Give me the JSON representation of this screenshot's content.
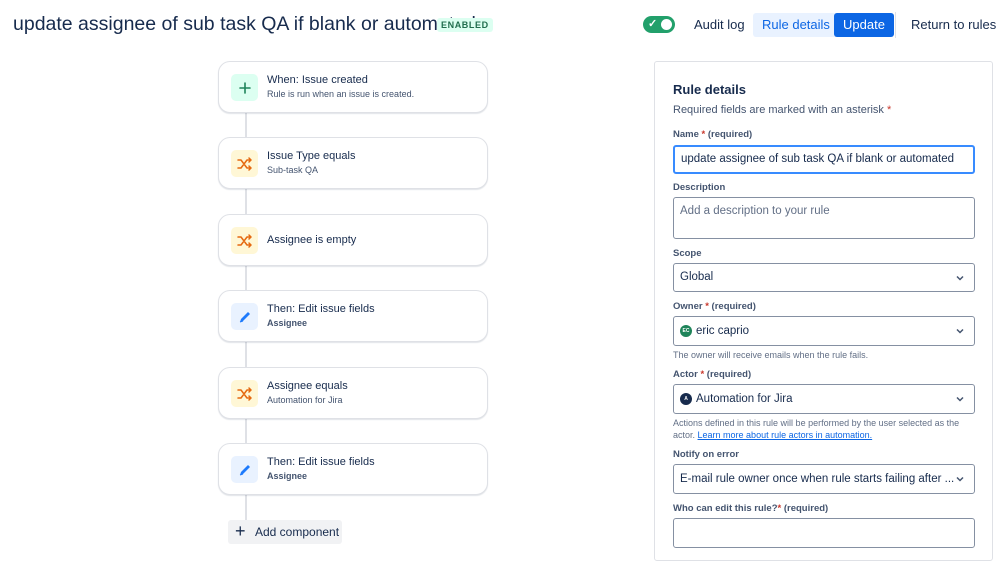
{
  "header": {
    "title": "update assignee of sub task QA if blank or automated",
    "status_badge": "ENABLED",
    "audit_log": "Audit log",
    "rule_details": "Rule details",
    "update": "Update",
    "return_to_rules": "Return to rules"
  },
  "flow": {
    "cards": [
      {
        "title": "When: Issue created",
        "subtitle": "Rule is run when an issue is created.",
        "icon": "plus-icon"
      },
      {
        "title": "Issue Type equals",
        "subtitle": "Sub-task QA",
        "icon": "shuffle-icon"
      },
      {
        "title": "Assignee is empty",
        "subtitle": "",
        "icon": "shuffle-icon"
      },
      {
        "title": "Then: Edit issue fields",
        "subtitle": "Assignee",
        "icon": "pencil-icon"
      },
      {
        "title": "Assignee equals",
        "subtitle": "Automation for Jira",
        "icon": "shuffle-icon"
      },
      {
        "title": "Then: Edit issue fields",
        "subtitle": "Assignee",
        "icon": "pencil-icon"
      }
    ],
    "add_component": "Add component"
  },
  "panel": {
    "title": "Rule details",
    "required_note": "Required fields are marked with an asterisk",
    "name_label": "Name",
    "name_required": "(required)",
    "name_value": "update assignee of sub task QA if blank or automated",
    "description_label": "Description",
    "description_placeholder": "Add a description to your rule",
    "scope_label": "Scope",
    "scope_value": "Global",
    "owner_label": "Owner",
    "owner_required": "(required)",
    "owner_initials": "EC",
    "owner_value": "eric caprio",
    "owner_help": "The owner will receive emails when the rule fails.",
    "actor_label": "Actor",
    "actor_required": "(required)",
    "actor_initials": "A",
    "actor_value": "Automation for Jira",
    "actor_help": "Actions defined in this rule will be performed by the user selected as the actor.",
    "actor_help_link": "Learn more about rule actors in automation.",
    "notify_label": "Notify on error",
    "notify_value": "E-mail rule owner once when rule starts failing after ...",
    "edit_label": "Who can edit this rule?",
    "edit_required": "(required)"
  },
  "colors": {
    "accent": "#0c66e4",
    "toggle_on": "#22a06b",
    "required_asterisk": "#c9372c"
  }
}
